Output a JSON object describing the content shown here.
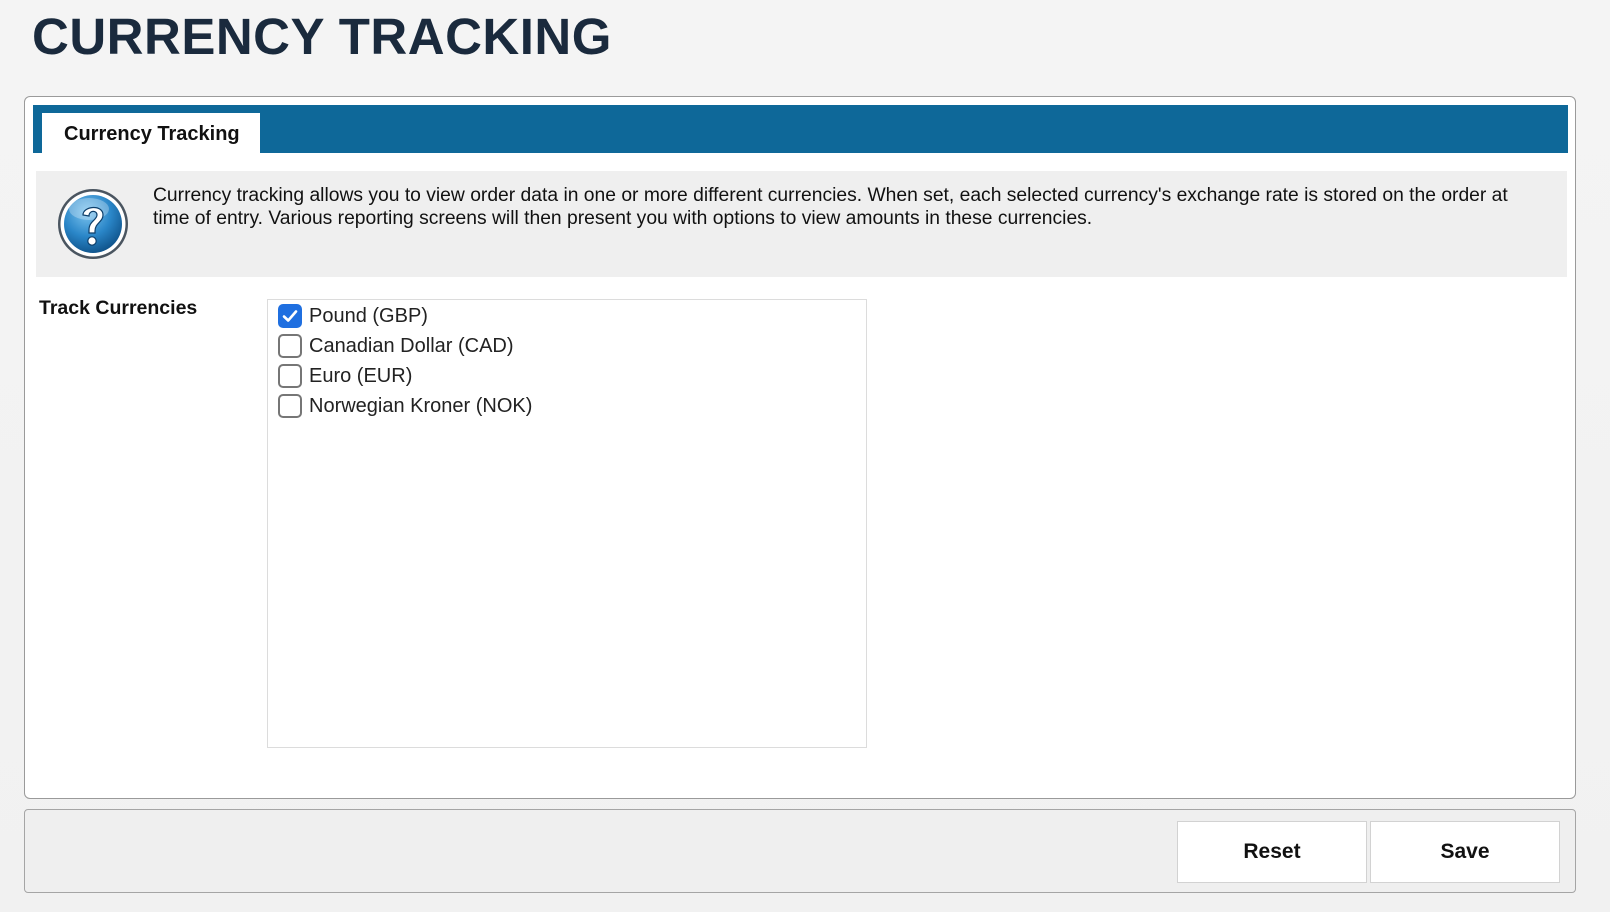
{
  "page": {
    "title": "CURRENCY TRACKING"
  },
  "tabs": [
    {
      "label": "Currency Tracking",
      "active": true
    }
  ],
  "info": {
    "icon": "help-question-icon",
    "text": "Currency tracking allows you to view order data in one or more different currencies. When set, each selected currency's exchange rate is stored on the order at time of entry. Various reporting screens will then present you with options to view amounts in these currencies."
  },
  "form": {
    "track_label": "Track Currencies",
    "currencies": [
      {
        "label": "Pound (GBP)",
        "checked": true
      },
      {
        "label": "Canadian Dollar (CAD)",
        "checked": false
      },
      {
        "label": "Euro (EUR)",
        "checked": false
      },
      {
        "label": "Norwegian Kroner (NOK)",
        "checked": false
      }
    ]
  },
  "actions": {
    "reset_label": "Reset",
    "save_label": "Save"
  },
  "colors": {
    "tab_bar": "#0e6899",
    "title": "#1a2a3d",
    "checkbox_checked": "#1f6fe0"
  }
}
